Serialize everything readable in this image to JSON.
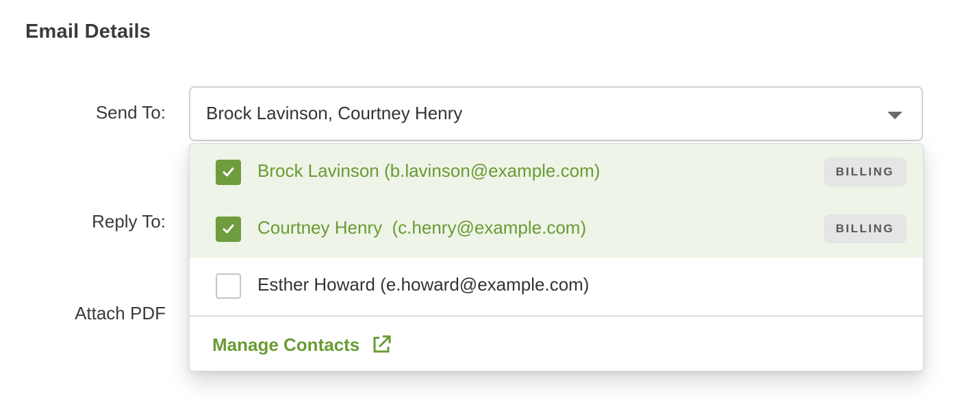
{
  "section": {
    "title": "Email Details"
  },
  "labels": {
    "send_to": "Send To:",
    "reply_to": "Reply To:",
    "attach_pdf": "Attach PDF"
  },
  "send_to_select": {
    "value": "Brock Lavinson, Courtney Henry",
    "icon": "caret-down-icon"
  },
  "dropdown": {
    "options": [
      {
        "text": "Brock Lavinson (b.lavinson@example.com)",
        "checked": true,
        "badge": "BILLING"
      },
      {
        "text": "Courtney Henry  (c.henry@example.com)",
        "checked": true,
        "badge": "BILLING"
      },
      {
        "text": "Esther Howard (e.howard@example.com)",
        "checked": false,
        "badge": ""
      }
    ],
    "manage_contacts": "Manage Contacts",
    "manage_icon": "external-link-icon"
  },
  "colors": {
    "accent_green": "#6a9a34",
    "checkbox_green": "#6f9c3d",
    "selected_row_bg": "#eef4e7",
    "badge_bg": "#e5e5e5"
  }
}
